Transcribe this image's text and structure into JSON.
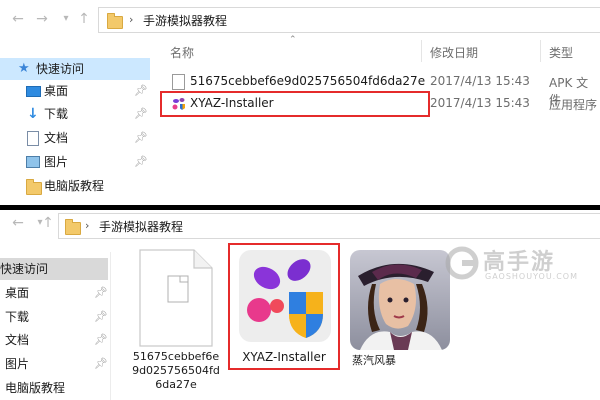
{
  "top": {
    "path": [
      "手游模拟器教程"
    ],
    "columns": {
      "name": "名称",
      "date": "修改日期",
      "type": "类型"
    },
    "sidebar": [
      {
        "label": "快速访问",
        "icon": "star-icon"
      },
      {
        "label": "桌面",
        "icon": "desktop-icon"
      },
      {
        "label": "下载",
        "icon": "download-icon"
      },
      {
        "label": "文档",
        "icon": "document-icon"
      },
      {
        "label": "图片",
        "icon": "picture-icon"
      },
      {
        "label": "电脑版教程",
        "icon": "folder-icon"
      }
    ],
    "files": [
      {
        "name": "51675cebbef6e9d025756504fd6da27e",
        "date": "2017/4/13 15:43",
        "type": "APK 文件"
      },
      {
        "name": "XYAZ-Installer",
        "date": "2017/4/13 15:43",
        "type": "应用程序"
      }
    ]
  },
  "bottom": {
    "path": [
      "手游模拟器教程"
    ],
    "sidebar": [
      {
        "label": "快速访问"
      },
      {
        "label": "桌面"
      },
      {
        "label": "下载"
      },
      {
        "label": "文档"
      },
      {
        "label": "图片"
      },
      {
        "label": "电脑版教程"
      }
    ],
    "tiles": [
      {
        "line1": "51675cebbef6e",
        "line2": "9d025756504fd",
        "line3": "6da27e"
      },
      {
        "name": "XYAZ-Installer"
      },
      {
        "name": "蒸汽风暴"
      }
    ]
  },
  "watermark": {
    "brand": "高手游",
    "domain": "GAOSHOUYOU.COM"
  },
  "colors": {
    "highlight": "#e52b2b",
    "selected_bg": "#cce8ff",
    "brand": "#2b6ed2"
  }
}
